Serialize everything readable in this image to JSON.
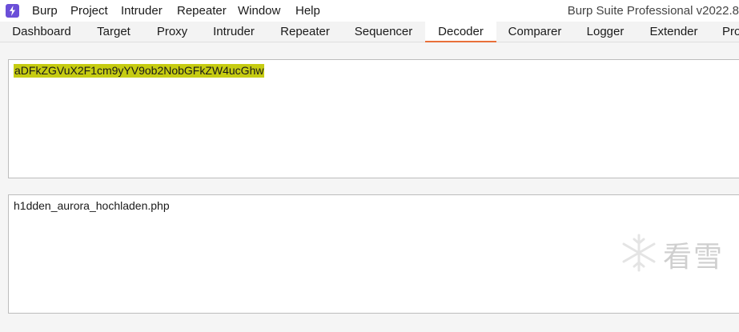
{
  "menubar": {
    "items": [
      "Burp",
      "Project",
      "Intruder",
      "Repeater",
      "Window",
      "Help"
    ],
    "app_title": "Burp Suite Professional v2022.8"
  },
  "tabs": [
    {
      "label": "Dashboard"
    },
    {
      "label": "Target"
    },
    {
      "label": "Proxy"
    },
    {
      "label": "Intruder"
    },
    {
      "label": "Repeater"
    },
    {
      "label": "Sequencer"
    },
    {
      "label": "Decoder",
      "active": true
    },
    {
      "label": "Comparer"
    },
    {
      "label": "Logger"
    },
    {
      "label": "Extender"
    },
    {
      "label": "Pro"
    }
  ],
  "decoder": {
    "input_text": "aDFkZGVuX2F1cm9yYV9ob2NobGFkZW4ucGhw",
    "output_text": "h1dden_aurora_hochladen.php"
  },
  "watermark": {
    "text": "看雪"
  },
  "colors": {
    "accent": "#e8703a",
    "highlight": "#c6cc12",
    "app_icon": "#6b4fd8"
  }
}
